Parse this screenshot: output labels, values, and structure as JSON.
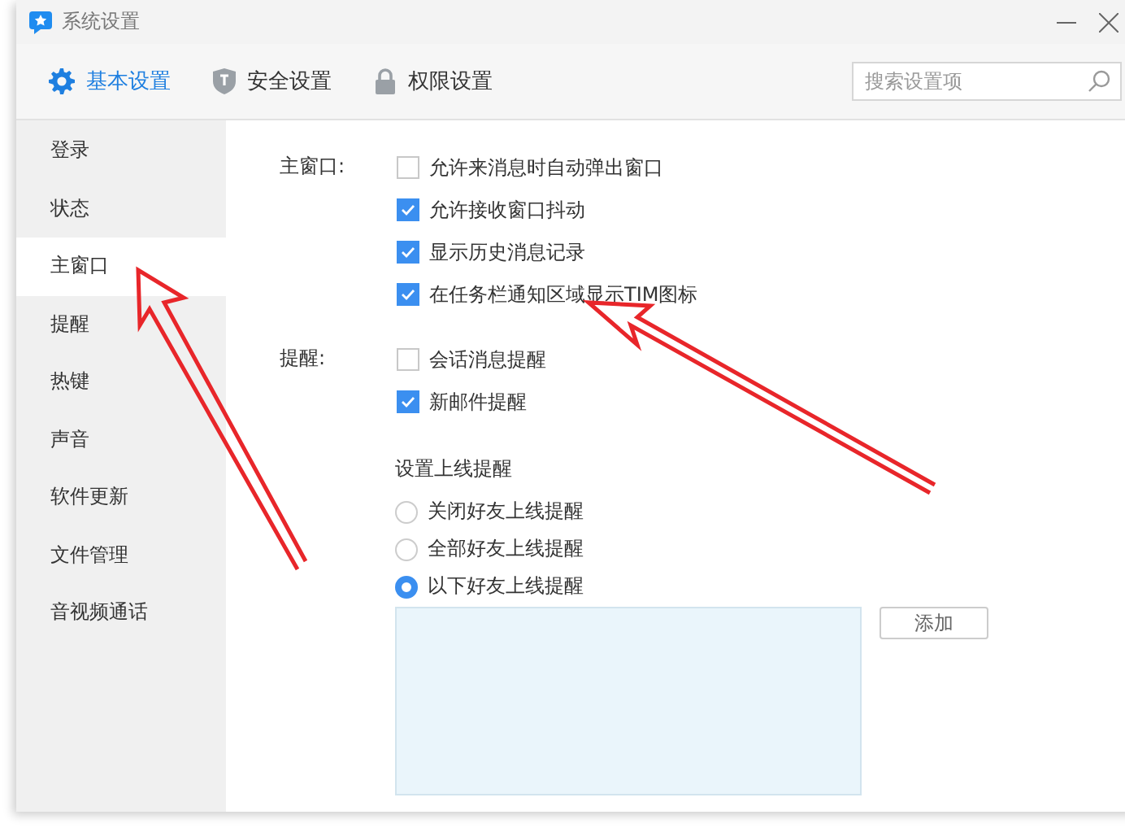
{
  "window": {
    "title": "系统设置"
  },
  "tabs": [
    {
      "label": "基本设置",
      "selected": true
    },
    {
      "label": "安全设置",
      "selected": false
    },
    {
      "label": "权限设置",
      "selected": false
    }
  ],
  "search": {
    "placeholder": "搜索设置项"
  },
  "sidebar": {
    "items": [
      {
        "label": "登录",
        "selected": false
      },
      {
        "label": "状态",
        "selected": false
      },
      {
        "label": "主窗口",
        "selected": true
      },
      {
        "label": "提醒",
        "selected": false
      },
      {
        "label": "热键",
        "selected": false
      },
      {
        "label": "声音",
        "selected": false
      },
      {
        "label": "软件更新",
        "selected": false
      },
      {
        "label": "文件管理",
        "selected": false
      },
      {
        "label": "音视频通话",
        "selected": false
      }
    ]
  },
  "sections": [
    {
      "label": "主窗口:",
      "options": [
        {
          "label": "允许来消息时自动弹出窗口",
          "checked": false
        },
        {
          "label": "允许接收窗口抖动",
          "checked": true
        },
        {
          "label": "显示历史消息记录",
          "checked": true
        },
        {
          "label": "在任务栏通知区域显示TIM图标",
          "checked": true
        }
      ]
    },
    {
      "label": "提醒:",
      "options": [
        {
          "label": "会话消息提醒",
          "checked": false
        },
        {
          "label": "新邮件提醒",
          "checked": true
        }
      ]
    }
  ],
  "online_reminder": {
    "title": "设置上线提醒",
    "options": [
      {
        "label": "关闭好友上线提醒",
        "selected": false
      },
      {
        "label": "全部好友上线提醒",
        "selected": false
      },
      {
        "label": "以下好友上线提醒",
        "selected": true
      }
    ],
    "add_button": "添加"
  }
}
